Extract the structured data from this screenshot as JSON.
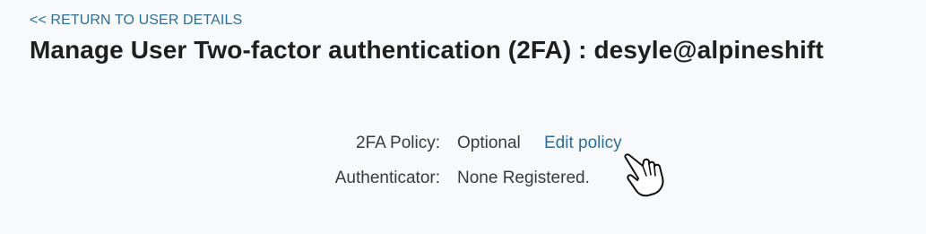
{
  "nav": {
    "back_label": "<< RETURN TO USER DETAILS"
  },
  "header": {
    "title": "Manage User Two-factor authentication (2FA) : desyle@alpineshift"
  },
  "details": {
    "policy": {
      "label": "2FA Policy:",
      "value": "Optional",
      "action_label": "Edit policy"
    },
    "authenticator": {
      "label": "Authenticator:",
      "value": "None Registered."
    }
  },
  "colors": {
    "background": "#f7f9fa",
    "link": "#2f6f95",
    "text": "#3a3a3a"
  },
  "icons": {
    "cursor": "hand-pointer-icon"
  }
}
